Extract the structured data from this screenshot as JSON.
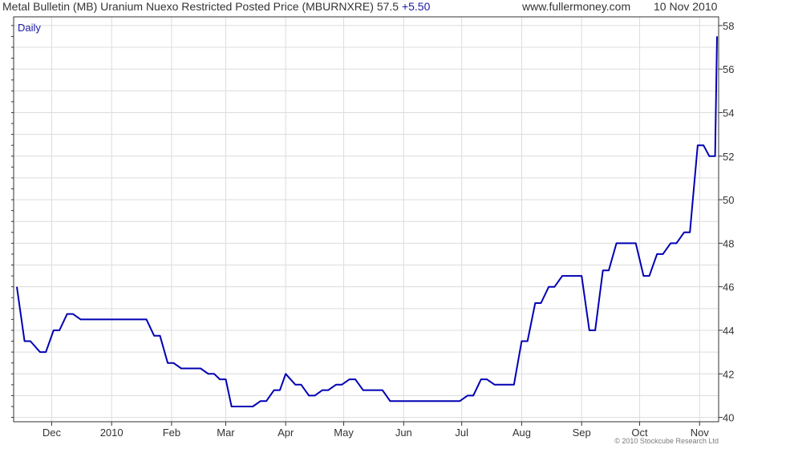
{
  "header": {
    "title": "Metal Bulletin (MB) Uranium Nuexo Restricted Posted Price (MBURNXRE)",
    "last": "57.5",
    "change": "+5.50",
    "site": "www.fullermoney.com",
    "date": "10 Nov 2010"
  },
  "period_label": "Daily",
  "copyright": "© 2010 Stockcube Research Ltd",
  "colors": {
    "line": "#0000b4",
    "grid": "#dcdcdc",
    "axis": "#333333"
  },
  "chart_data": {
    "type": "line",
    "title": "Metal Bulletin (MB) Uranium Nuexo Restricted Posted Price (MBURNXRE)",
    "xlabel": "",
    "ylabel": "",
    "ylim": [
      39.8,
      58.4
    ],
    "y_ticks": [
      40,
      42,
      44,
      46,
      48,
      50,
      52,
      54,
      56,
      58
    ],
    "y_axis_side": "right",
    "grid": true,
    "x_ticks": [
      {
        "label": "Dec",
        "date": "2009-12-01"
      },
      {
        "label": "2010",
        "date": "2010-01-01"
      },
      {
        "label": "Feb",
        "date": "2010-02-01"
      },
      {
        "label": "Mar",
        "date": "2010-03-01"
      },
      {
        "label": "Apr",
        "date": "2010-04-01"
      },
      {
        "label": "May",
        "date": "2010-05-01"
      },
      {
        "label": "Jun",
        "date": "2010-06-01"
      },
      {
        "label": "Jul",
        "date": "2010-07-01"
      },
      {
        "label": "Aug",
        "date": "2010-08-01"
      },
      {
        "label": "Sep",
        "date": "2010-09-01"
      },
      {
        "label": "Oct",
        "date": "2010-10-01"
      },
      {
        "label": "Nov",
        "date": "2010-11-01"
      }
    ],
    "xlim": [
      "2009-11-13",
      "2010-11-10"
    ],
    "series": [
      {
        "points": [
          [
            "2009-11-13",
            46.0
          ],
          [
            "2009-11-17",
            43.5
          ],
          [
            "2009-11-20",
            43.5
          ],
          [
            "2009-11-25",
            43.0
          ],
          [
            "2009-11-28",
            43.0
          ],
          [
            "2009-12-02",
            44.0
          ],
          [
            "2009-12-05",
            44.0
          ],
          [
            "2009-12-09",
            44.75
          ],
          [
            "2009-12-12",
            44.75
          ],
          [
            "2009-12-16",
            44.5
          ],
          [
            "2009-12-23",
            44.5
          ],
          [
            "2010-01-01",
            44.5
          ],
          [
            "2010-01-15",
            44.5
          ],
          [
            "2010-01-19",
            44.5
          ],
          [
            "2010-01-23",
            43.75
          ],
          [
            "2010-01-26",
            43.75
          ],
          [
            "2010-01-30",
            42.5
          ],
          [
            "2010-02-02",
            42.5
          ],
          [
            "2010-02-06",
            42.25
          ],
          [
            "2010-02-16",
            42.25
          ],
          [
            "2010-02-20",
            42.0
          ],
          [
            "2010-02-23",
            42.0
          ],
          [
            "2010-02-26",
            41.75
          ],
          [
            "2010-03-01",
            41.75
          ],
          [
            "2010-03-04",
            40.5
          ],
          [
            "2010-03-15",
            40.5
          ],
          [
            "2010-03-19",
            40.75
          ],
          [
            "2010-03-22",
            40.75
          ],
          [
            "2010-03-26",
            41.25
          ],
          [
            "2010-03-29",
            41.25
          ],
          [
            "2010-04-01",
            42.0
          ],
          [
            "2010-04-06",
            41.5
          ],
          [
            "2010-04-09",
            41.5
          ],
          [
            "2010-04-13",
            41.0
          ],
          [
            "2010-04-16",
            41.0
          ],
          [
            "2010-04-20",
            41.25
          ],
          [
            "2010-04-23",
            41.25
          ],
          [
            "2010-04-27",
            41.5
          ],
          [
            "2010-04-30",
            41.5
          ],
          [
            "2010-05-04",
            41.75
          ],
          [
            "2010-05-07",
            41.75
          ],
          [
            "2010-05-11",
            41.25
          ],
          [
            "2010-05-21",
            41.25
          ],
          [
            "2010-05-25",
            40.75
          ],
          [
            "2010-06-30",
            40.75
          ],
          [
            "2010-07-04",
            41.0
          ],
          [
            "2010-07-07",
            41.0
          ],
          [
            "2010-07-11",
            41.75
          ],
          [
            "2010-07-14",
            41.75
          ],
          [
            "2010-07-18",
            41.5
          ],
          [
            "2010-07-28",
            41.5
          ],
          [
            "2010-08-01",
            43.5
          ],
          [
            "2010-08-04",
            43.5
          ],
          [
            "2010-08-08",
            45.25
          ],
          [
            "2010-08-11",
            45.25
          ],
          [
            "2010-08-15",
            46.0
          ],
          [
            "2010-08-18",
            46.0
          ],
          [
            "2010-08-22",
            46.5
          ],
          [
            "2010-09-01",
            46.5
          ],
          [
            "2010-09-05",
            44.0
          ],
          [
            "2010-09-08",
            44.0
          ],
          [
            "2010-09-12",
            46.75
          ],
          [
            "2010-09-15",
            46.75
          ],
          [
            "2010-09-19",
            48.0
          ],
          [
            "2010-09-29",
            48.0
          ],
          [
            "2010-10-03",
            46.5
          ],
          [
            "2010-10-06",
            46.5
          ],
          [
            "2010-10-10",
            47.5
          ],
          [
            "2010-10-13",
            47.5
          ],
          [
            "2010-10-17",
            48.0
          ],
          [
            "2010-10-20",
            48.0
          ],
          [
            "2010-10-24",
            48.5
          ],
          [
            "2010-10-27",
            48.5
          ],
          [
            "2010-10-31",
            52.5
          ],
          [
            "2010-11-03",
            52.5
          ],
          [
            "2010-11-06",
            52.0
          ],
          [
            "2010-11-09",
            52.0
          ],
          [
            "2010-11-10",
            57.5
          ]
        ]
      }
    ]
  }
}
